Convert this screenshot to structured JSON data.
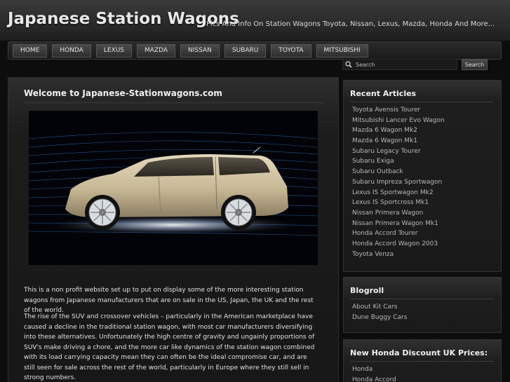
{
  "header": {
    "title": "Japanese Station Wagons",
    "tagline": "Pics And Info On Station Wagons Toyota, Nissan, Lexus, Mazda, Honda And More..."
  },
  "nav": {
    "items": [
      "Home",
      "Honda",
      "Lexus",
      "Mazda",
      "Nissan",
      "Subaru",
      "Toyota",
      "Mitsubishi"
    ]
  },
  "search": {
    "placeholder": "Search",
    "button_label": "Search"
  },
  "main": {
    "title": "Welcome to Japanese-Stationwagons.com",
    "paragraphs": [
      "This is a non profit website set up to put on display some of the more interesting station wagons from Japanese manufacturers that are on sale in the US, Japan, the UK and the rest of the world.",
      "The rise of the SUV and crossover vehicles – particularly in the American marketplace have caused a decline in the traditional station wagon, with most car manufacturers diversifying into these alternatives. Unfortunately the high centre of gravity and ungainly proportions of SUV's make driving a chore, and the more car like dynamics of the station wagon combined with its load carrying capacity mean they can often be the ideal compromise car, and are still seen for sale across the rest of the world, particularly in Europe where they still sell in strong numbers."
    ]
  },
  "sidebar": {
    "recent": {
      "heading": "Recent Articles",
      "items": [
        "Toyota Avensis Tourer",
        "Mitsubishi Lancer Evo Wagon",
        "Mazda 6 Wagon Mk2",
        "Mazda 6 Wagon Mk1",
        "Subaru Legacy Tourer",
        "Subaru Exiga",
        "Subaru Outback",
        "Subaru Impreza Sportwagon",
        "Lexus IS Sportwagon Mk2",
        "Lexus IS Sportcross Mk1",
        "Nissan Primera Wagon",
        "Nissan Primera Wagon Mk1",
        "Honda Accord Tourer",
        "Honda Accord Wagon 2003",
        "Toyota Venza"
      ]
    },
    "blogroll": {
      "heading": "Blogroll",
      "items": [
        "About Kit Cars",
        "Dune Buggy Cars"
      ]
    },
    "prices": {
      "heading": "New Honda Discount UK Prices:",
      "items": [
        "Honda",
        "Honda Accord"
      ]
    }
  },
  "colors": {
    "background": "#0d0d0d",
    "header_bg": "#2e2e2e",
    "link": "#b8b8b8",
    "heading": "#f0f0f0",
    "car_body": "#cdbf9e"
  }
}
